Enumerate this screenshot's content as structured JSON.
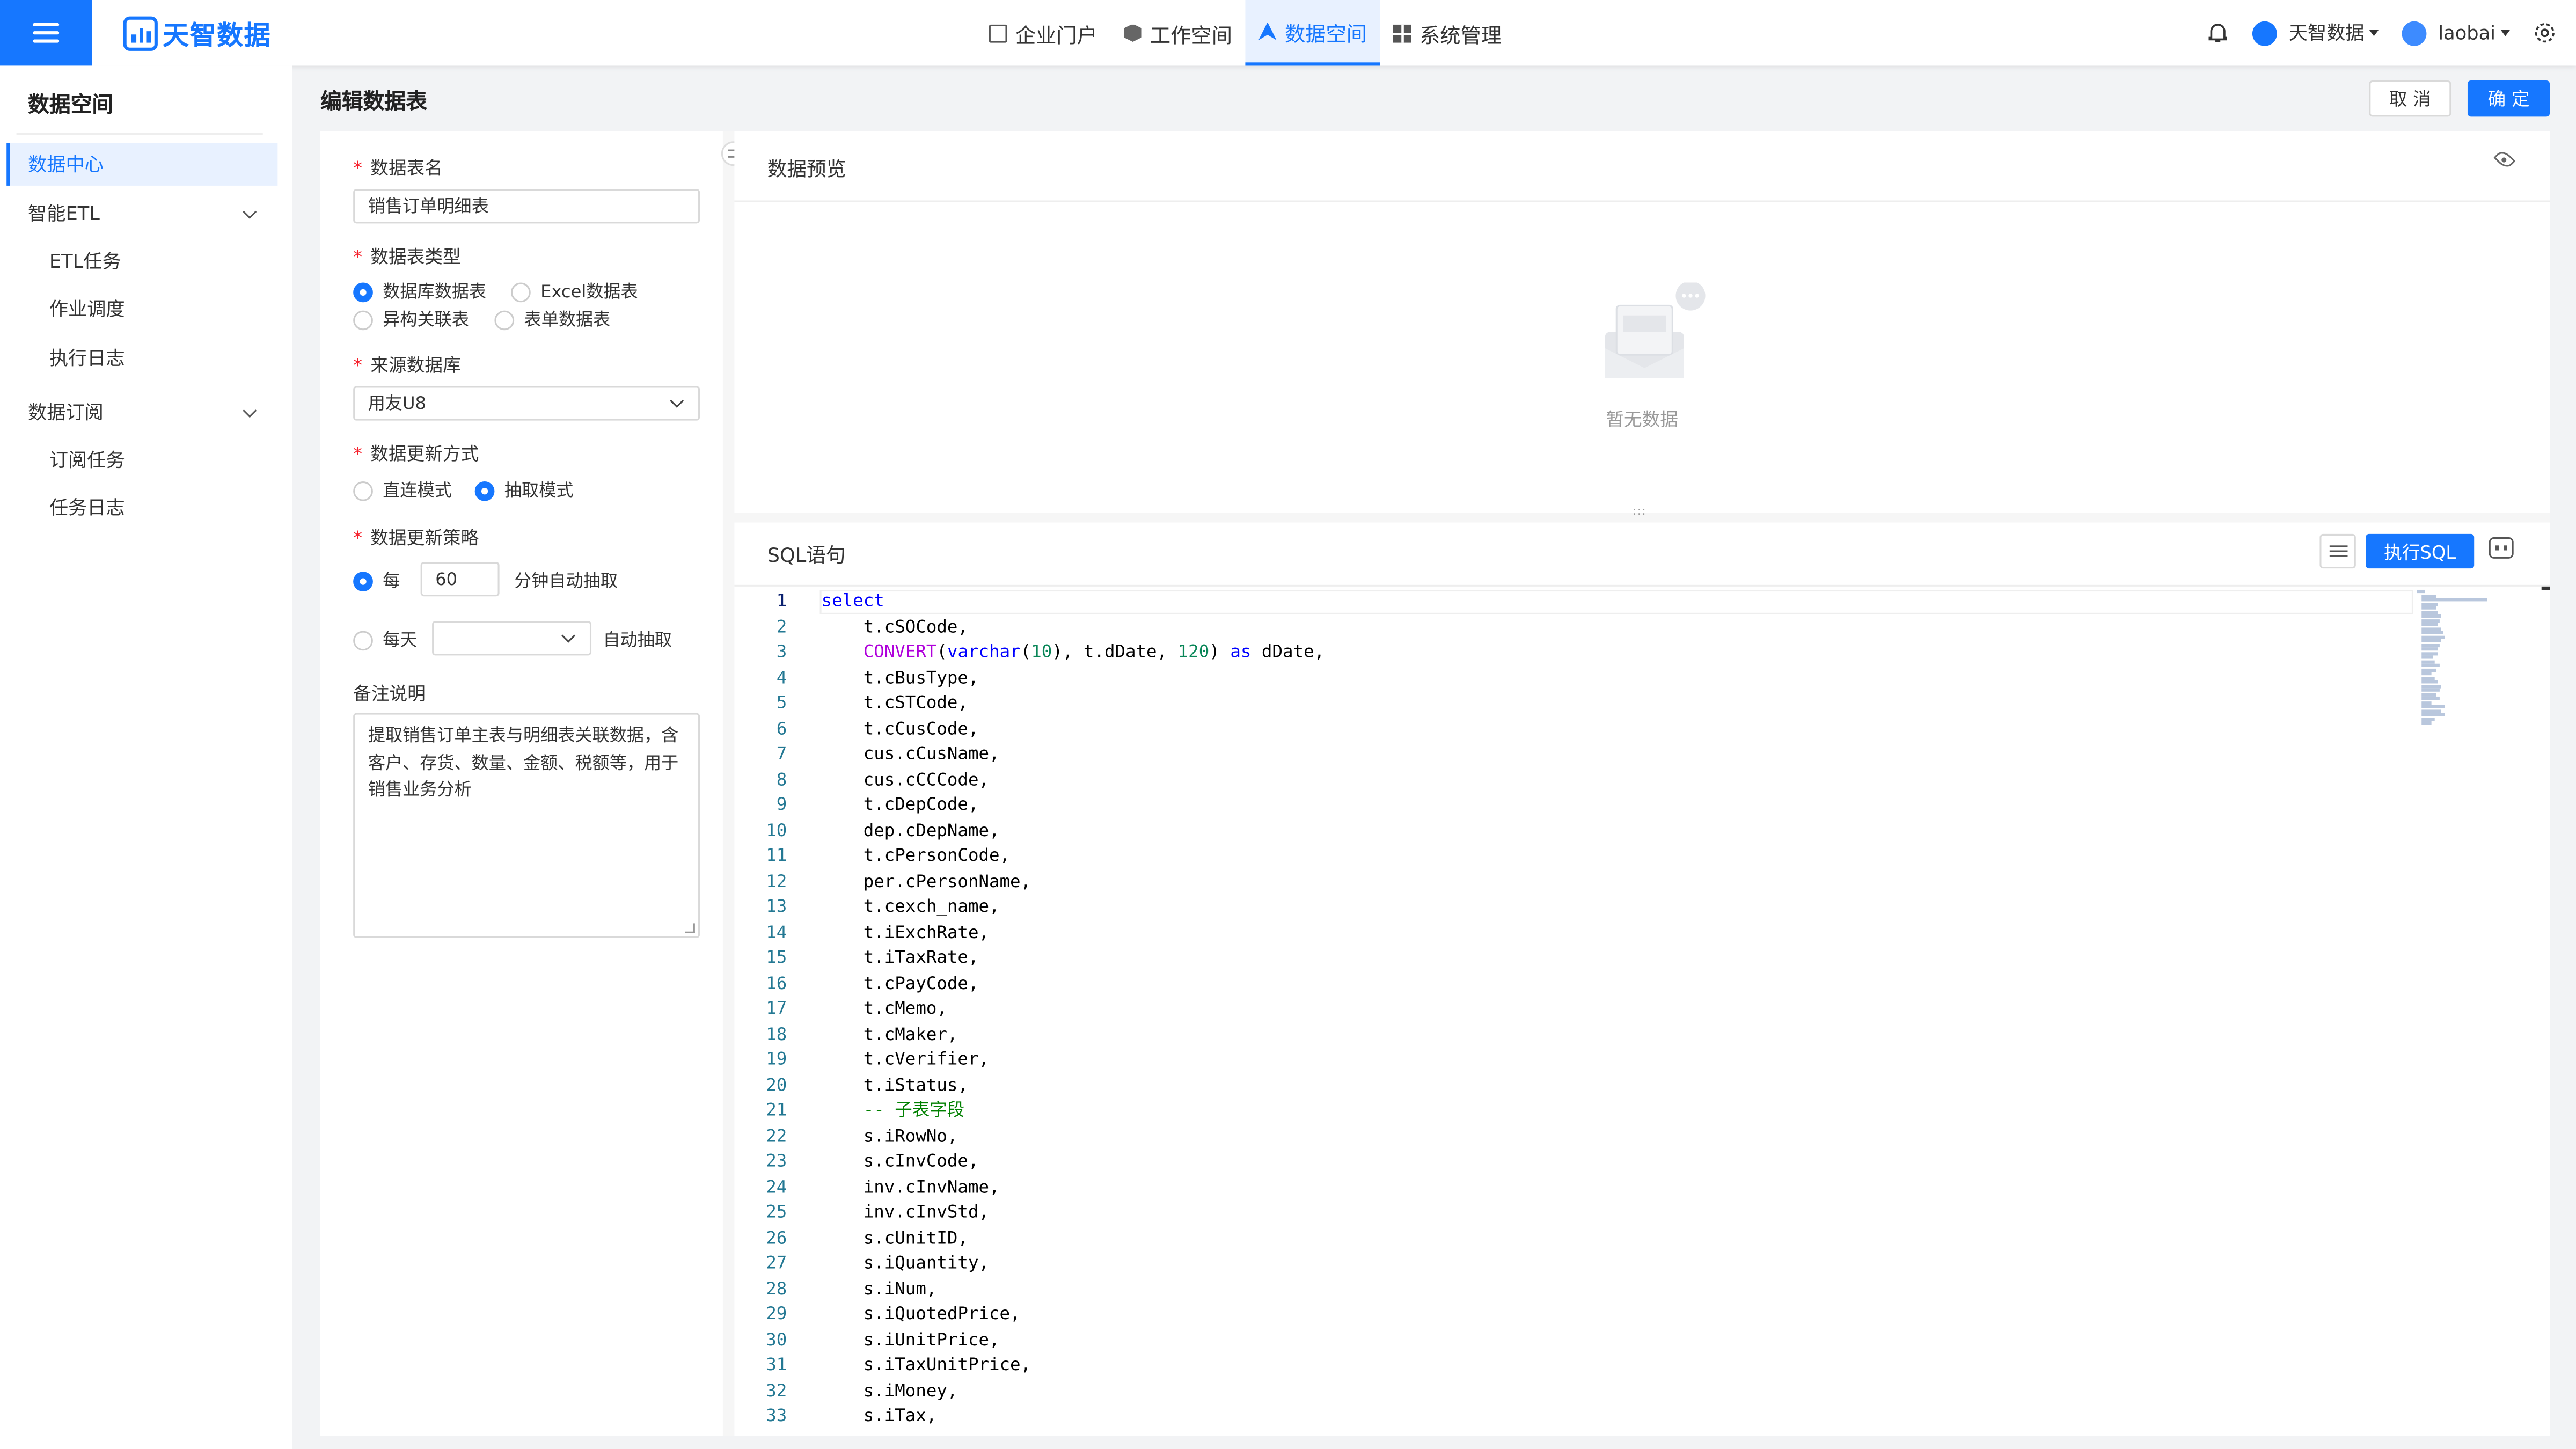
{
  "topbar": {
    "logo": "天智数据",
    "nav": [
      "企业门户",
      "工作空间",
      "数据空间",
      "系统管理"
    ],
    "active_nav": "数据空间",
    "tenant": "天智数据",
    "user": "laobai"
  },
  "sidebar": {
    "title": "数据空间",
    "items": [
      {
        "label": "数据中心",
        "active": true
      },
      {
        "label": "智能ETL",
        "expandable": true
      },
      {
        "label": "ETL任务",
        "sub": true
      },
      {
        "label": "作业调度",
        "sub": true
      },
      {
        "label": "执行日志",
        "sub": true
      },
      {
        "label": "数据订阅",
        "expandable": true
      },
      {
        "label": "订阅任务",
        "sub": true
      },
      {
        "label": "任务日志",
        "sub": true
      }
    ]
  },
  "page": {
    "title": "编辑数据表",
    "cancel": "取 消",
    "ok": "确 定"
  },
  "form": {
    "name_label": "数据表名",
    "name_value": "销售订单明细表",
    "type_label": "数据表类型",
    "type_options": [
      "数据库数据表",
      "Excel数据表",
      "异构关联表",
      "表单数据表"
    ],
    "type_selected": "数据库数据表",
    "source_label": "来源数据库",
    "source_value": "用友U8",
    "update_label": "数据更新方式",
    "update_options": [
      "直连模式",
      "抽取模式"
    ],
    "update_selected": "抽取模式",
    "strategy_label": "数据更新策略",
    "strategy_every": "每",
    "strategy_minutes": "60",
    "strategy_minutes_suffix": "分钟自动抽取",
    "strategy_daily": "每天",
    "strategy_daily_suffix": "自动抽取",
    "remark_label": "备注说明",
    "remark_value": "提取销售订单主表与明细表关联数据，含客户、存货、数量、金额、税额等，用于销售业务分析"
  },
  "preview": {
    "title": "数据预览",
    "empty": "暂无数据"
  },
  "sql": {
    "title": "SQL语句",
    "execute": "执行SQL",
    "lines": [
      "select",
      "    t.cSOCode,",
      "    CONVERT(varchar(10), t.dDate, 120) as dDate,",
      "    t.cBusType,",
      "    t.cSTCode,",
      "    t.cCusCode,",
      "    cus.cCusName,",
      "    cus.cCCCode,",
      "    t.cDepCode,",
      "    dep.cDepName,",
      "    t.cPersonCode,",
      "    per.cPersonName,",
      "    t.cexch_name,",
      "    t.iExchRate,",
      "    t.iTaxRate,",
      "    t.cPayCode,",
      "    t.cMemo,",
      "    t.cMaker,",
      "    t.cVerifier,",
      "    t.iStatus,",
      "    -- 子表字段",
      "    s.iRowNo,",
      "    s.cInvCode,",
      "    inv.cInvName,",
      "    inv.cInvStd,",
      "    s.cUnitID,",
      "    s.iQuantity,",
      "    s.iNum,",
      "    s.iQuotedPrice,",
      "    s.iUnitPrice,",
      "    s.iTaxUnitPrice,",
      "    s.iMoney,",
      "    s.iTax,"
    ]
  }
}
